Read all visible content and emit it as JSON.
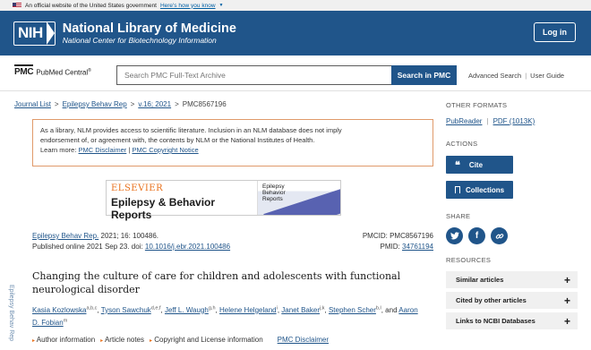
{
  "gov_banner": {
    "text": "An official website of the United States government",
    "link": "Here's how you know"
  },
  "header": {
    "logo": "NIH",
    "title": "National Library of Medicine",
    "subtitle": "National Center for Biotechnology Information",
    "login": "Log in"
  },
  "search": {
    "brand_mark": "PMC",
    "brand_name": "PubMed Central",
    "brand_reg": "®",
    "placeholder": "Search PMC Full-Text Archive",
    "button": "Search in PMC",
    "advanced": "Advanced Search",
    "sep": "|",
    "guide": "User Guide"
  },
  "breadcrumb": {
    "items": [
      "Journal List",
      "Epilepsy Behav Rep",
      "v.16; 2021"
    ],
    "current": "PMC8567196",
    "sep": ">"
  },
  "disclaimer": {
    "line1": "As a library, NLM provides access to scientific literature. Inclusion in an NLM database does not imply",
    "line2": "endorsement of, or agreement with, the contents by NLM or the National Institutes of Health.",
    "learn_more": "Learn more:",
    "link1": "PMC Disclaimer",
    "sep": "|",
    "link2": "PMC Copyright Notice"
  },
  "journal_banner": {
    "publisher": "ELSEVIER",
    "title": "Epilepsy & Behavior Reports",
    "cover_line1": "Epilepsy",
    "cover_line2": "Behavior",
    "cover_line3": "Reports"
  },
  "side_label": "Epilepsy Behav Rep",
  "citation": {
    "journal": "Epilepsy Behav Rep.",
    "details": " 2021; 16: 100486.",
    "published": "Published online 2021 Sep 23. doi: ",
    "doi": "10.1016/j.ebr.2021.100486",
    "pmcid": "PMCID: PMC8567196",
    "pmid_label": "PMID: ",
    "pmid": "34761194"
  },
  "article": {
    "title": "Changing the culture of care for children and adolescents with functional neurological disorder",
    "authors": [
      {
        "name": "Kasia Kozlowska",
        "sup": "a,b,c",
        "sep": ","
      },
      {
        "name": "Tyson Sawchuk",
        "sup": "d,e,f",
        "sep": ","
      },
      {
        "name": "Jeff L. Waugh",
        "sup": "g,h",
        "sep": ","
      },
      {
        "name": "Helene Helgeland",
        "sup": "i",
        "sep": ","
      },
      {
        "name": "Janet Baker",
        "sup": "j,k",
        "sep": ","
      },
      {
        "name": "Stephen Scher",
        "sup": "b,l",
        "sep": ", and"
      },
      {
        "name": "Aaron D. Fobian",
        "sup": "m",
        "sep": ""
      }
    ]
  },
  "info": {
    "author_info": "Author information",
    "article_notes": "Article notes",
    "copyright": "Copyright and License information",
    "disclaimer": "PMC Disclaimer"
  },
  "sidebar": {
    "other_formats": "OTHER FORMATS",
    "pubreader": "PubReader",
    "sep": "|",
    "pdf": "PDF (1013K)",
    "actions": "ACTIONS",
    "cite": "Cite",
    "collections": "Collections",
    "share": "SHARE",
    "resources": "RESOURCES",
    "resource_items": [
      "Similar articles",
      "Cited by other articles",
      "Links to NCBI Databases"
    ]
  },
  "colors": {
    "brand": "#20558a",
    "accent": "#e9711c",
    "border": "#e09a6a"
  }
}
